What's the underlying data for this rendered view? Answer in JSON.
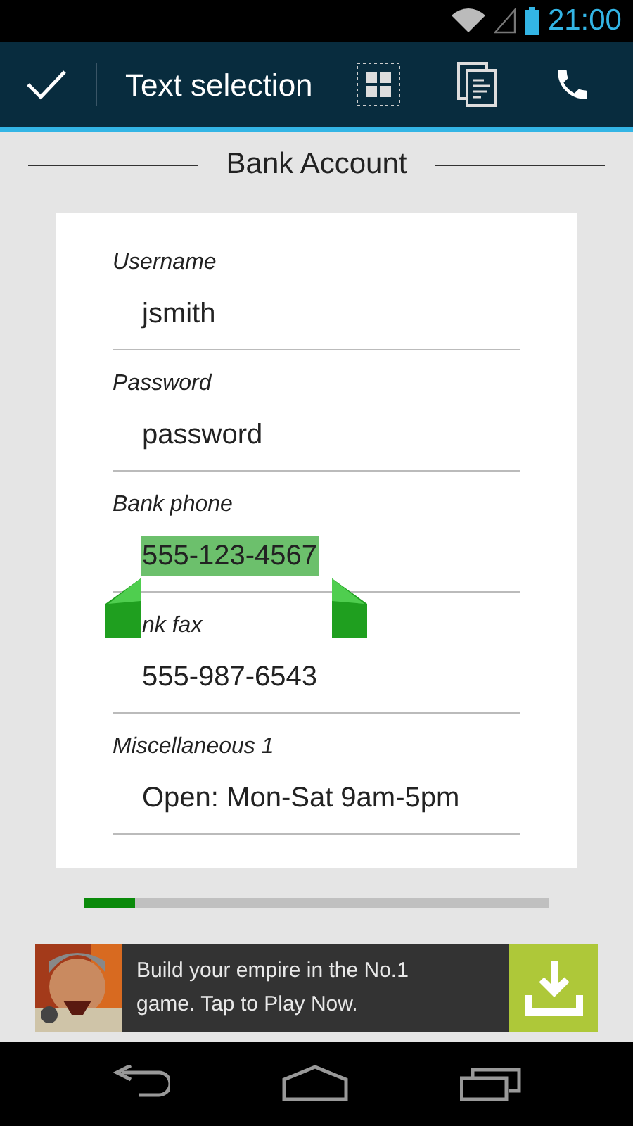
{
  "status_bar": {
    "time": "21:00"
  },
  "action_bar": {
    "title": "Text selection"
  },
  "section": {
    "title": "Bank Account"
  },
  "fields": [
    {
      "label": "Username",
      "value": "jsmith",
      "selected": false
    },
    {
      "label": "Password",
      "value": "password",
      "selected": false
    },
    {
      "label": "Bank phone",
      "value": "555-123-4567",
      "selected": true
    },
    {
      "label": "nk fax",
      "value": "555-987-6543",
      "selected": false
    },
    {
      "label": "Miscellaneous 1",
      "value": "Open: Mon-Sat 9am-5pm",
      "selected": false
    }
  ],
  "progress": {
    "level": 0.11
  },
  "ad": {
    "text": "Build your empire in the No.1 game. Tap to Play Now."
  }
}
